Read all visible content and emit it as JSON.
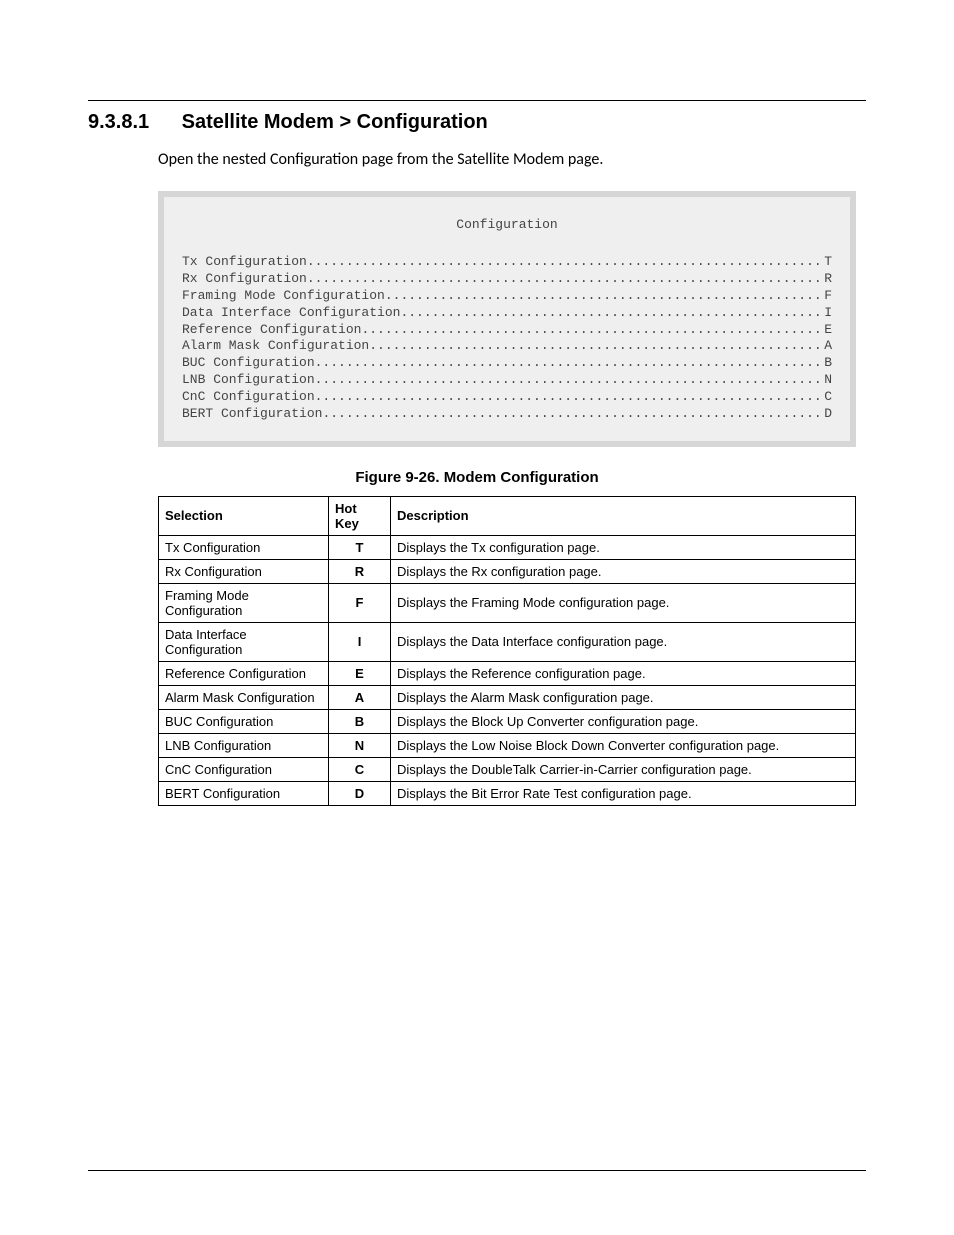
{
  "heading": {
    "number": "9.3.8.1",
    "title": "Satellite Modem > Configuration"
  },
  "intro": "Open the nested Configuration page from the Satellite Modem page.",
  "terminal": {
    "title": "Configuration",
    "items": [
      {
        "label": "Tx Configuration",
        "key": "T"
      },
      {
        "label": "Rx Configuration",
        "key": "R"
      },
      {
        "label": "Framing Mode Configuration",
        "key": "F"
      },
      {
        "label": "Data Interface Configuration",
        "key": "I"
      },
      {
        "label": "Reference Configuration",
        "key": "E"
      },
      {
        "label": "Alarm Mask Configuration",
        "key": "A"
      },
      {
        "label": "BUC Configuration",
        "key": "B"
      },
      {
        "label": "LNB Configuration",
        "key": "N"
      },
      {
        "label": "CnC Configuration",
        "key": "C"
      },
      {
        "label": "BERT Configuration",
        "key": "D"
      }
    ]
  },
  "figure_caption": "Figure 9-26. Modem Configuration",
  "table": {
    "headers": {
      "selection": "Selection",
      "hotkey": "Hot Key",
      "description": "Description"
    },
    "rows": [
      {
        "selection": "Tx Configuration",
        "hotkey": "T",
        "description": "Displays the Tx configuration page."
      },
      {
        "selection": "Rx Configuration",
        "hotkey": "R",
        "description": "Displays the Rx configuration page."
      },
      {
        "selection": "Framing Mode Configuration",
        "hotkey": "F",
        "description": "Displays the  Framing Mode configuration page."
      },
      {
        "selection": "Data Interface Configuration",
        "hotkey": "I",
        "description": "Displays the Data Interface configuration page."
      },
      {
        "selection": "Reference Configuration",
        "hotkey": "E",
        "description": "Displays the Reference configuration page."
      },
      {
        "selection": "Alarm Mask Configuration",
        "hotkey": "A",
        "description": "Displays the Alarm Mask configuration page."
      },
      {
        "selection": "BUC Configuration",
        "hotkey": "B",
        "description": "Displays the Block Up Converter configuration page."
      },
      {
        "selection": "LNB Configuration",
        "hotkey": "N",
        "description": "Displays the Low Noise Block Down Converter configuration page."
      },
      {
        "selection": "CnC Configuration",
        "hotkey": "C",
        "description": "Displays the DoubleTalk Carrier-in-Carrier configuration page."
      },
      {
        "selection": "BERT Configuration",
        "hotkey": "D",
        "description": "Displays the Bit Error Rate Test configuration page."
      }
    ]
  }
}
